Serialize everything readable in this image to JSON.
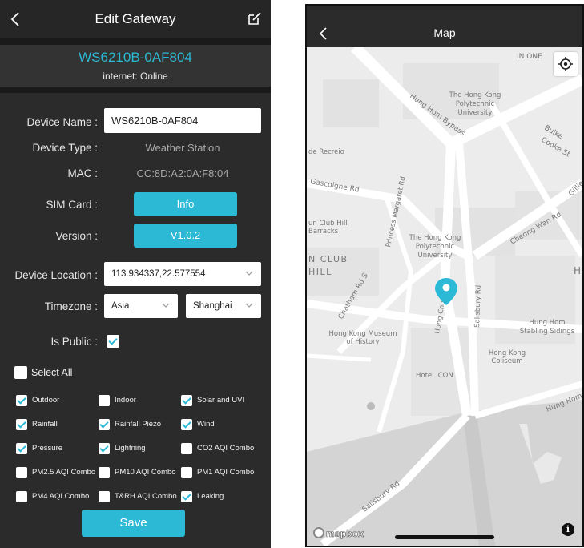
{
  "edit_gateway": {
    "title": "Edit Gateway",
    "serial": "WS6210B-0AF804",
    "internet_status": "internet: Online",
    "device_name_label": "Device Name :",
    "device_name_value": "WS6210B-0AF804",
    "device_type_label": "Device Type :",
    "device_type_value": "Weather Station",
    "mac_label": "MAC :",
    "mac_value": "CC:8D:A2:0A:F8:04",
    "sim_label": "SIM Card :",
    "sim_button": "Info",
    "version_label": "Version :",
    "version_button": "V1.0.2",
    "location_label": "Device Location :",
    "location_value": "113.934337,22.577554",
    "timezone_label": "Timezone :",
    "timezone_region": "Asia",
    "timezone_city": "Shanghai",
    "public_label": "Is Public :",
    "public_checked": true,
    "select_all_label": "Select All",
    "select_all_checked": false,
    "options": [
      {
        "label": "Outdoor",
        "checked": true
      },
      {
        "label": "Indoor",
        "checked": false
      },
      {
        "label": "Solar and UVI",
        "checked": true
      },
      {
        "label": "Rainfall",
        "checked": true
      },
      {
        "label": "Rainfall Piezo",
        "checked": true
      },
      {
        "label": "Wind",
        "checked": true
      },
      {
        "label": "Pressure",
        "checked": true
      },
      {
        "label": "Lightning",
        "checked": true
      },
      {
        "label": "CO2 AQI Combo",
        "checked": false
      },
      {
        "label": "PM2.5 AQI Combo",
        "checked": false
      },
      {
        "label": "PM10 AQI Combo",
        "checked": false
      },
      {
        "label": "PM1 AQI Combo",
        "checked": false
      },
      {
        "label": "PM4 AQI Combo",
        "checked": false
      },
      {
        "label": "T&RH AQI Combo",
        "checked": false
      },
      {
        "label": "Leaking",
        "checked": true
      }
    ],
    "save_label": "Save"
  },
  "map": {
    "title": "Map",
    "labels": {
      "in_one": "IN ONE",
      "polyu_top": [
        "The Hong Kong",
        "Polytechnic",
        "University"
      ],
      "hung_hom_bypass": "Hung Hom Bypass",
      "bulkeley": "Bulke",
      "cooke": "Cooke St",
      "de_recreio": "de Recreio",
      "gascoigne": "Gascoigne Rd",
      "princess_margaret": "Princess Margaret Rd",
      "gun_club": [
        "un Club Hill",
        "Barracks"
      ],
      "polyu_mid": [
        "The Hong Kong",
        "Polytechnic",
        "University"
      ],
      "cheong_wan": "Cheong Wan Rd",
      "n_club": "N CLUB",
      "hill": "HILL",
      "h": "H",
      "chatham": "Chatham Rd S",
      "hong_chong": "Hong Chong Rd",
      "salisbury_v": "Salisbury Rd",
      "museum": [
        "Hong Kong Museum",
        "of History"
      ],
      "hung_hom_stabling": [
        "Hung Hom",
        "Stabling Sidings"
      ],
      "coliseum": [
        "Hong Kong",
        "Coliseum"
      ],
      "hotel_icon": "Hotel ICON",
      "hung_hom_bypass2": "Hung Hom B",
      "salisbury_low": "Salisbury Rd",
      "gillie": "Gillie"
    },
    "attribution": "mapbox",
    "info_icon": "i",
    "colors": {
      "accent": "#2bb9d5"
    }
  }
}
